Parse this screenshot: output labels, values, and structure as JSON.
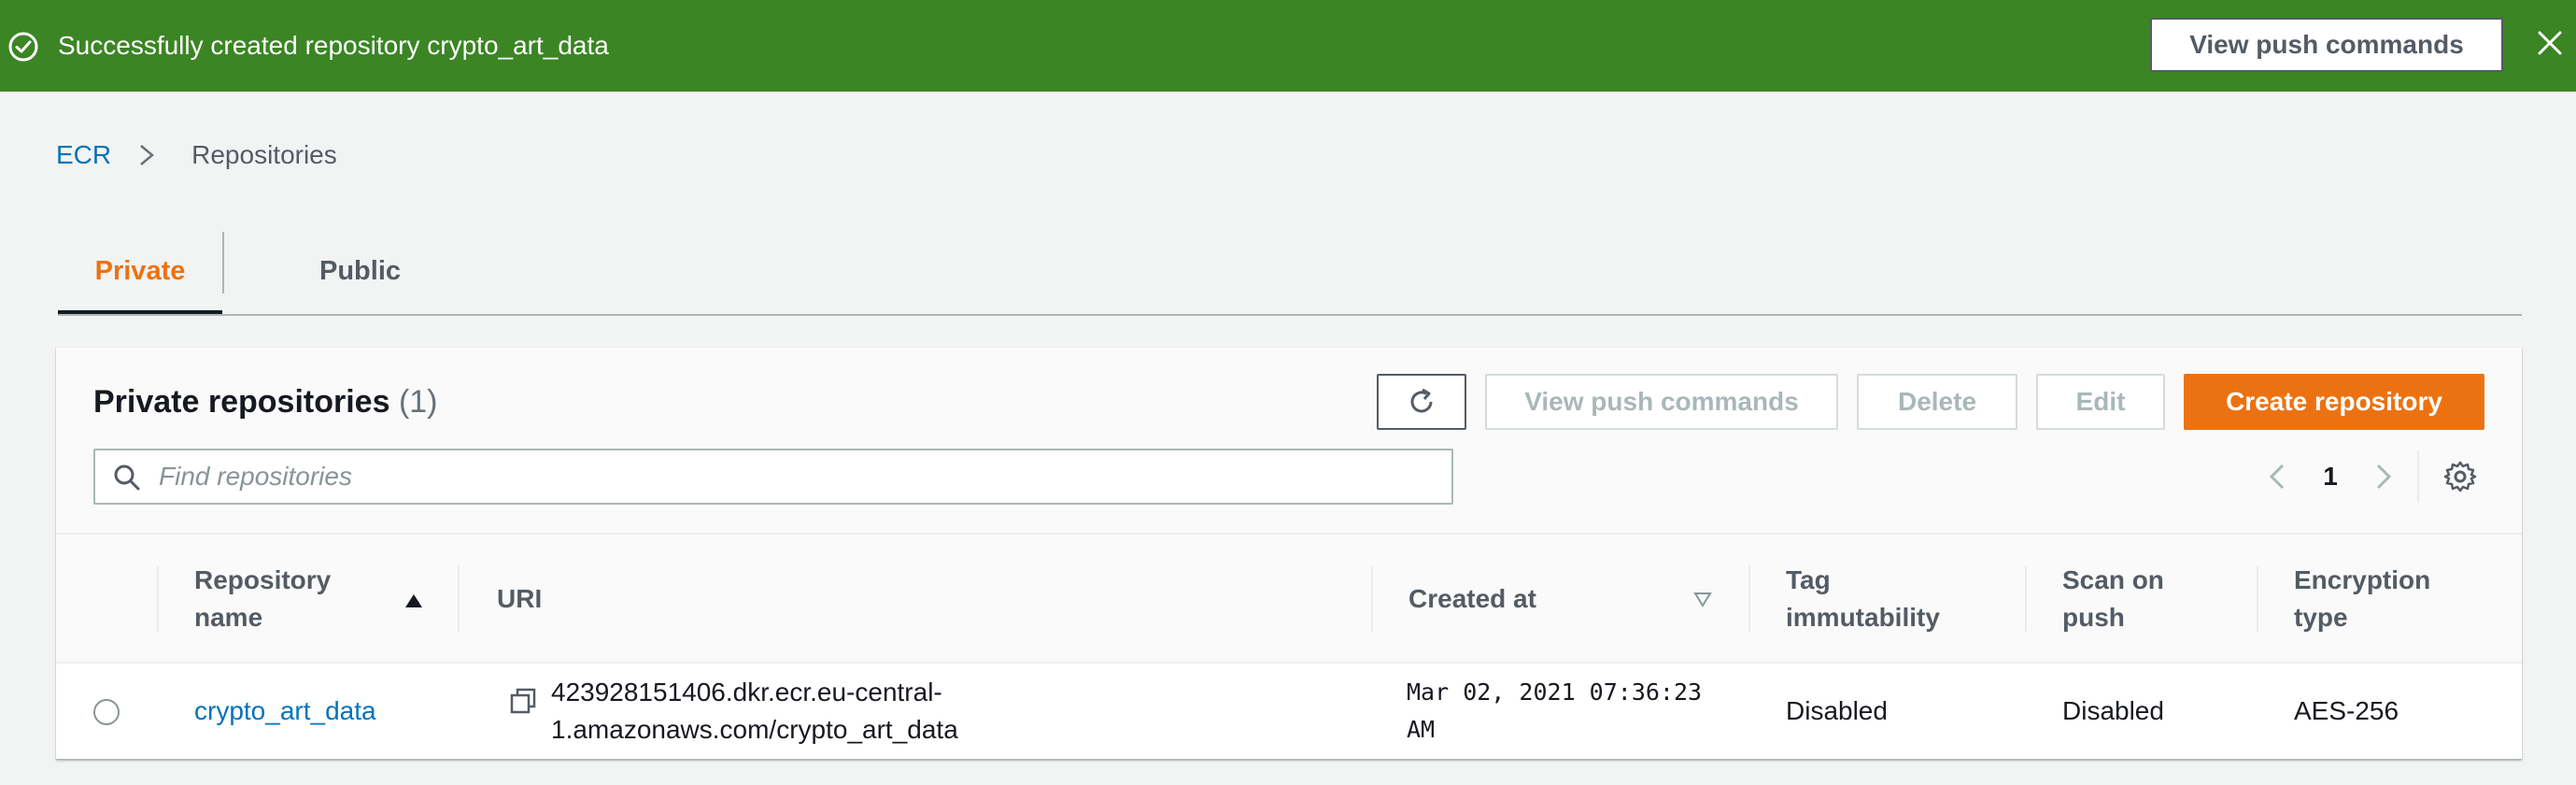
{
  "flash": {
    "message": "Successfully created repository crypto_art_data",
    "action_label": "View push commands",
    "color": "#3b8524"
  },
  "breadcrumb": {
    "root": "ECR",
    "current": "Repositories"
  },
  "tabs": [
    {
      "label": "Private",
      "selected": true
    },
    {
      "label": "Public",
      "selected": false
    }
  ],
  "panel": {
    "title": "Private repositories",
    "count": "(1)",
    "buttons": {
      "view_push_commands": "View push commands",
      "delete": "Delete",
      "edit": "Edit",
      "create": "Create repository"
    },
    "search": {
      "placeholder": "Find repositories",
      "value": ""
    },
    "pagination": {
      "current_page": "1"
    }
  },
  "table": {
    "columns": [
      {
        "label": "Repository name"
      },
      {
        "label": "URI"
      },
      {
        "label": "Created at"
      },
      {
        "label": "Tag immutability"
      },
      {
        "label": "Scan on push"
      },
      {
        "label": "Encryption type"
      }
    ],
    "rows": [
      {
        "name": "crypto_art_data",
        "uri_line1": "423928151406.dkr.ecr.eu-central-",
        "uri_line2": "1.amazonaws.com/crypto_art_data",
        "created_line1": "Mar 02, 2021 07:36:23",
        "created_line2": "AM",
        "tag_immutability": "Disabled",
        "scan_on_push": "Disabled",
        "encryption": "AES-256"
      }
    ]
  },
  "colors": {
    "accent": "#ec7211",
    "link": "#0073bb",
    "success": "#3b8524"
  }
}
